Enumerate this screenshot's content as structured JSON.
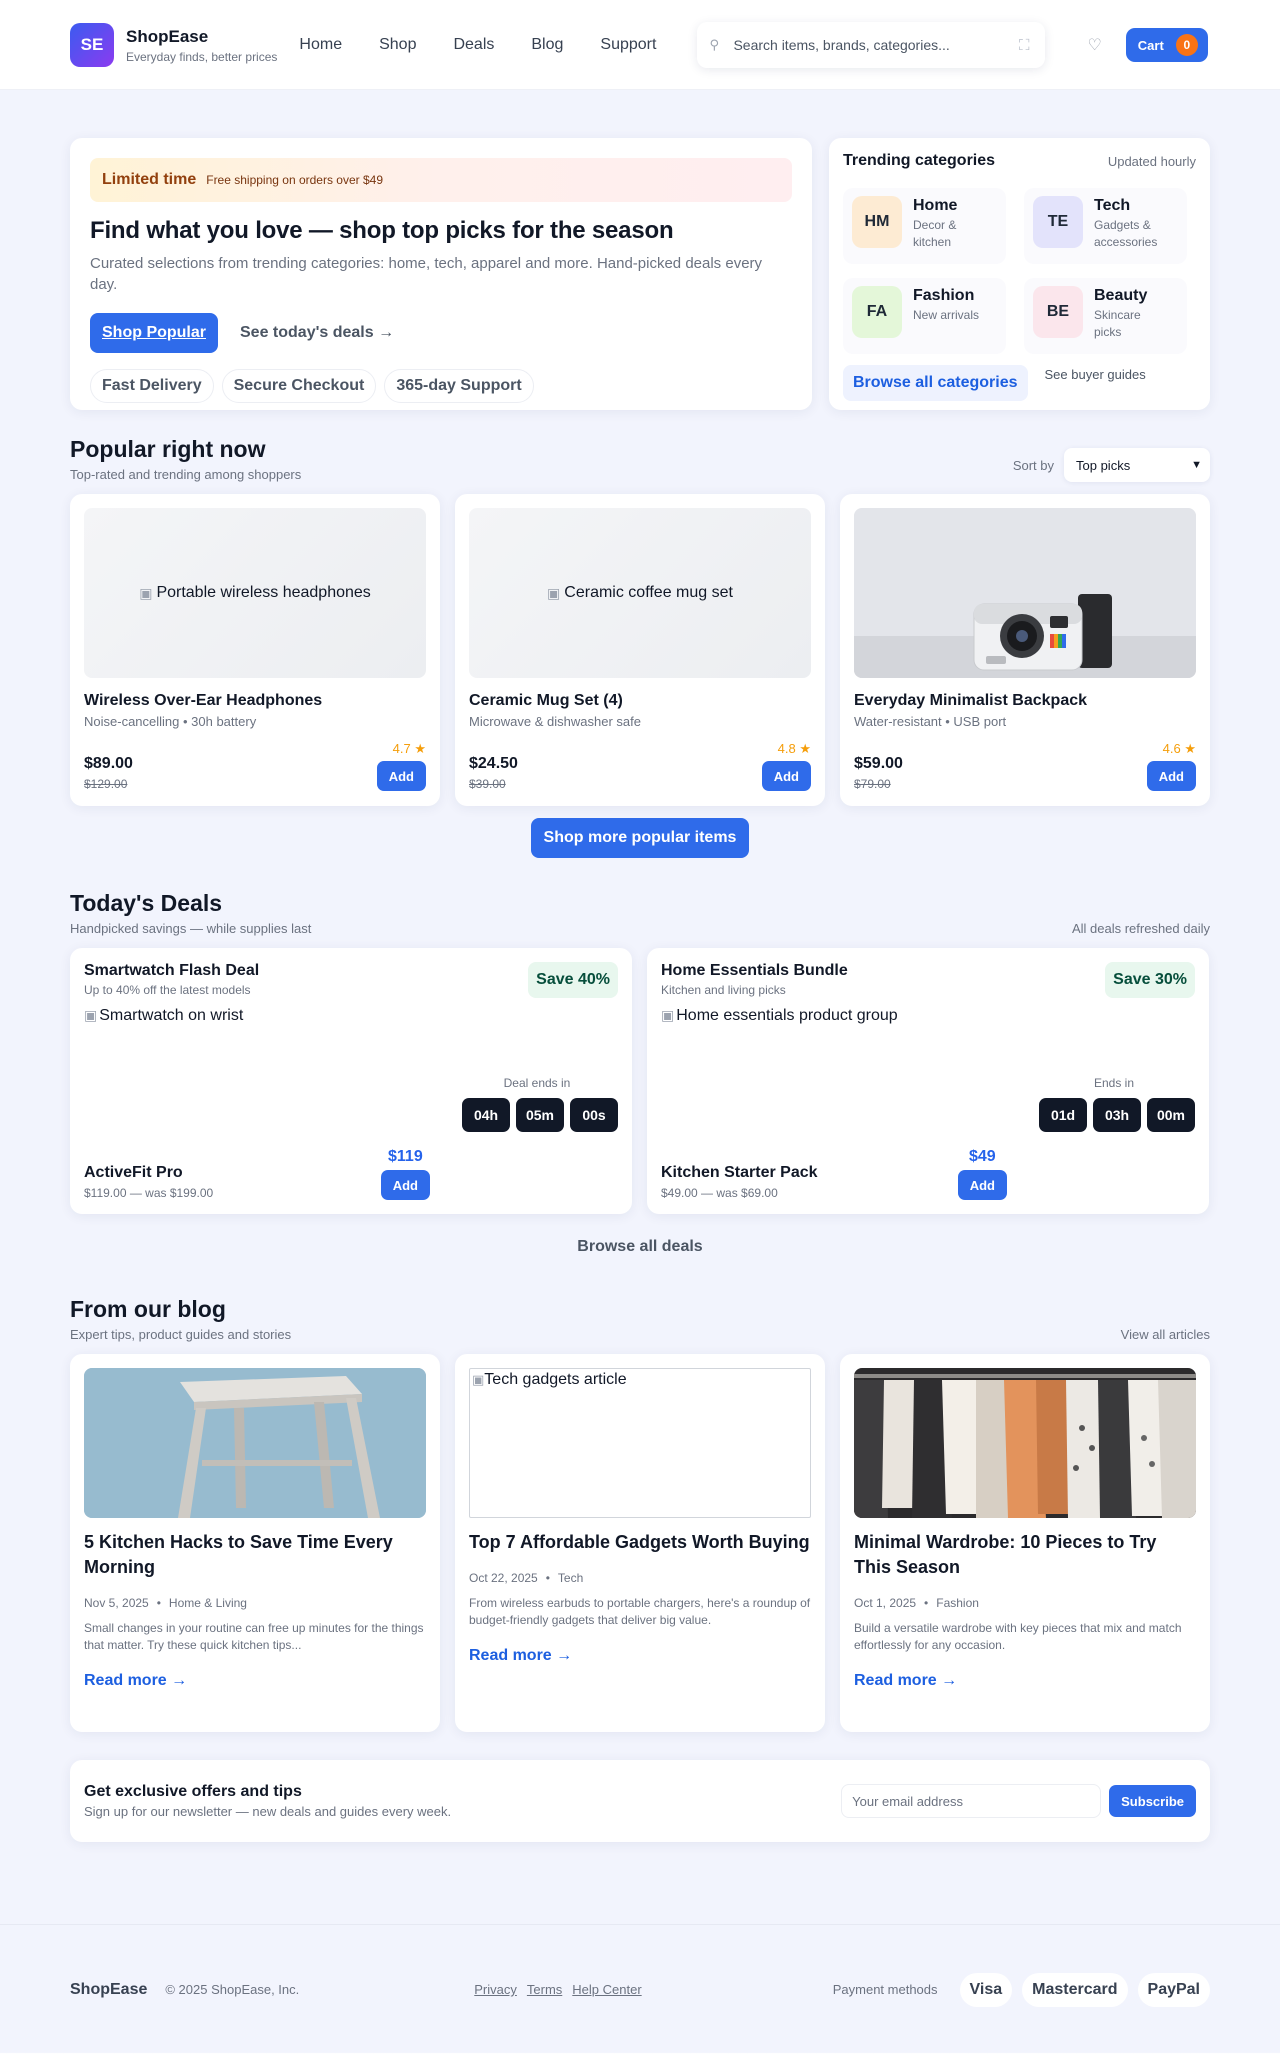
{
  "header": {
    "logo": "SE",
    "brand_name": "ShopEase",
    "tagline": "Everyday finds, better prices",
    "nav": [
      "Home",
      "Shop",
      "Deals",
      "Blog",
      "Support"
    ],
    "search_placeholder": "Search items, brands, categories...",
    "cart_label": "Cart",
    "cart_count": "0"
  },
  "hero": {
    "promo_label": "Limited time",
    "promo_text": "Free shipping on orders over $49",
    "title": "Find what you love — shop top picks for the season",
    "subtitle": "Curated selections from trending categories: home, tech, apparel and more. Hand-picked deals every day.",
    "primary_cta": "Shop Popular",
    "secondary_cta": "See today's deals →",
    "chips": [
      "Fast Delivery",
      "Secure Checkout",
      "365-day Support"
    ]
  },
  "trending": {
    "title": "Trending categories",
    "updated": "Updated hourly",
    "categories": [
      {
        "badge": "HM",
        "name": "Home",
        "desc": "Decor & kitchen",
        "color": "#fdebd3"
      },
      {
        "badge": "TE",
        "name": "Tech",
        "desc": "Gadgets & accessories",
        "color": "#e3e3fb"
      },
      {
        "badge": "FA",
        "name": "Fashion",
        "desc": "New arrivals",
        "color": "#e4f7d9"
      },
      {
        "badge": "BE",
        "name": "Beauty",
        "desc": "Skincare picks",
        "color": "#fbe6ec"
      }
    ],
    "browse_label": "Browse all categories",
    "guides_label": "See buyer guides"
  },
  "popular": {
    "title": "Popular right now",
    "subtitle": "Top-rated and trending among shoppers",
    "sort_label": "Sort by",
    "sort_value": "Top picks",
    "products": [
      {
        "img_alt": "Portable wireless headphones",
        "name": "Wireless Over-Ear Headphones",
        "desc": "Noise-cancelling • 30h battery",
        "price": "$89.00",
        "was": "$129.00",
        "rating": "4.7 ★",
        "add": "Add"
      },
      {
        "img_alt": "Ceramic coffee mug set",
        "name": "Ceramic Mug Set (4)",
        "desc": "Microwave & dishwasher safe",
        "price": "$24.50",
        "was": "$39.00",
        "rating": "4.8 ★",
        "add": "Add"
      },
      {
        "img_alt": "",
        "name": "Everyday Minimalist Backpack",
        "desc": "Water-resistant • USB port",
        "price": "$59.00",
        "was": "$79.00",
        "rating": "4.6 ★",
        "add": "Add"
      }
    ],
    "more_label": "Shop more popular items"
  },
  "deals": {
    "title": "Today's Deals",
    "subtitle": "Handpicked savings — while supplies last",
    "refreshed": "All deals refreshed daily",
    "items": [
      {
        "title": "Smartwatch Flash Deal",
        "sub": "Up to 40% off the latest models",
        "save": "Save 40%",
        "img_alt": "Smartwatch on wrist",
        "timer_label": "Deal ends in",
        "timer": [
          "04h",
          "05m",
          "00s"
        ],
        "name": "ActiveFit Pro",
        "was": "$119.00 — was $199.00",
        "price": "$119",
        "add": "Add"
      },
      {
        "title": "Home Essentials Bundle",
        "sub": "Kitchen and living picks",
        "save": "Save 30%",
        "img_alt": "Home essentials product group",
        "timer_label": "Ends in",
        "timer": [
          "01d",
          "03h",
          "00m"
        ],
        "name": "Kitchen Starter Pack",
        "was": "$49.00 — was $69.00",
        "price": "$49",
        "add": "Add"
      }
    ],
    "browse_label": "Browse all deals"
  },
  "blog": {
    "title": "From our blog",
    "subtitle": "Expert tips, product guides and stories",
    "view_all": "View all articles",
    "posts": [
      {
        "img_alt": "",
        "title": "5 Kitchen Hacks to Save Time Every Morning",
        "date": "Nov 5, 2025",
        "category": "Home & Living",
        "excerpt": "Small changes in your routine can free up minutes for the things that matter. Try these quick kitchen tips...",
        "read_more": "Read more →"
      },
      {
        "img_alt": "Tech gadgets article",
        "title": "Top 7 Affordable Gadgets Worth Buying",
        "date": "Oct 22, 2025",
        "category": "Tech",
        "excerpt": "From wireless earbuds to portable chargers, here's a roundup of budget-friendly gadgets that deliver big value.",
        "read_more": "Read more →"
      },
      {
        "img_alt": "",
        "title": "Minimal Wardrobe: 10 Pieces to Try This Season",
        "date": "Oct 1, 2025",
        "category": "Fashion",
        "excerpt": "Build a versatile wardrobe with key pieces that mix and match effortlessly for any occasion.",
        "read_more": "Read more →"
      }
    ]
  },
  "newsletter": {
    "title": "Get exclusive offers and tips",
    "subtitle": "Sign up for our newsletter — new deals and guides every week.",
    "placeholder": "Your email address",
    "button": "Subscribe"
  },
  "footer": {
    "brand": "ShopEase",
    "copyright": "© 2025 ShopEase, Inc.",
    "links": [
      "Privacy",
      "Terms",
      "Help Center"
    ],
    "payment_label": "Payment methods",
    "payments": [
      "Visa",
      "Mastercard",
      "PayPal"
    ]
  },
  "colors": {
    "accent": "#2f6bea",
    "cart_badge": "#f97316",
    "rating": "#f59e0b",
    "save_badge": "#e8f7ee"
  }
}
